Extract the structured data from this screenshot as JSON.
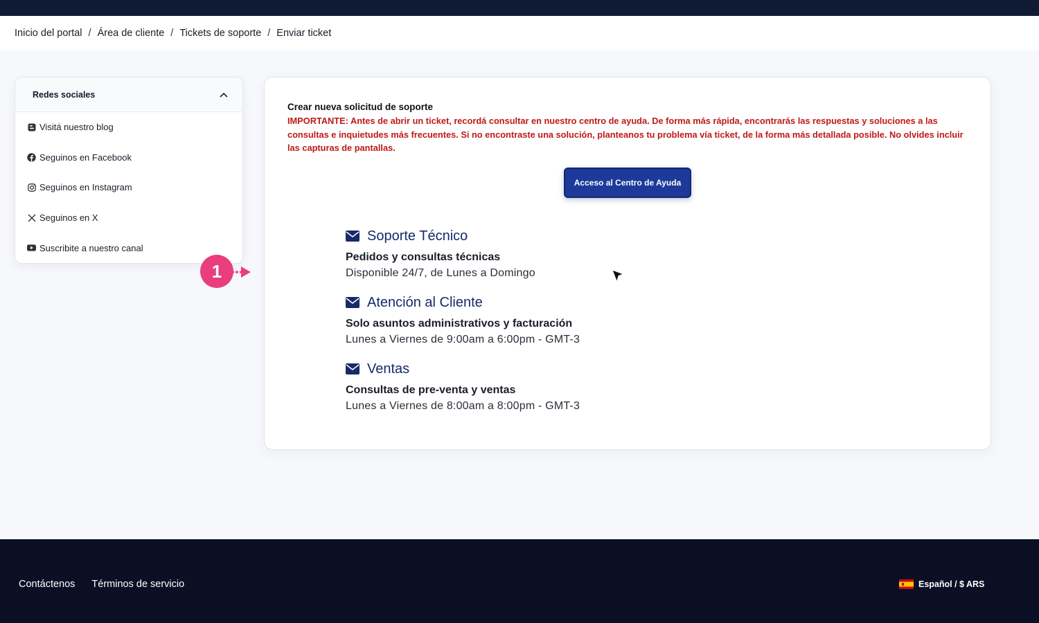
{
  "breadcrumb": {
    "items": [
      "Inicio del portal",
      "Área de cliente",
      "Tickets de soporte",
      "Enviar ticket"
    ],
    "separator": "/"
  },
  "sidebar": {
    "title": "Redes sociales",
    "items": [
      {
        "label": "Visitá nuestro blog",
        "icon": "blog-icon"
      },
      {
        "label": "Seguinos en Facebook",
        "icon": "facebook-icon"
      },
      {
        "label": "Seguinos en Instagram",
        "icon": "instagram-icon"
      },
      {
        "label": "Seguinos en X",
        "icon": "x-icon"
      },
      {
        "label": "Suscribite a nuestro canal",
        "icon": "youtube-icon"
      }
    ]
  },
  "main": {
    "title": "Crear nueva solicitud de soporte",
    "warning": "IMPORTANTE: Antes de abrir un ticket, recordá consultar en nuestro centro de ayuda. De forma más rápida, encontrarás las respuestas y soluciones a las consultas e inquietudes más frecuentes. Si no encontraste una solución, planteanos tu problema vía ticket, de la forma más detallada posible. No olvides incluir las capturas de pantallas.",
    "help_button": "Acceso al Centro de Ayuda",
    "departments": [
      {
        "name": "Soporte Técnico",
        "subtitle": "Pedidos y consultas técnicas",
        "hours": "Disponible 24/7, de Lunes a Domingo"
      },
      {
        "name": "Atención al Cliente",
        "subtitle": "Solo asuntos administrativos y facturación",
        "hours": "Lunes a Viernes de 9:00am a 6:00pm - GMT-3"
      },
      {
        "name": "Ventas",
        "subtitle": "Consultas de pre-venta y ventas",
        "hours": "Lunes a Viernes de 8:00am a 8:00pm - GMT-3"
      }
    ]
  },
  "callout": {
    "number": "1"
  },
  "footer": {
    "links": [
      "Contáctenos",
      "Términos de servicio"
    ],
    "language": "Español / $ ARS"
  },
  "colors": {
    "topbar": "#0f1a33",
    "footer": "#0a0f24",
    "accent": "#1d3a9a",
    "warning": "#c01818",
    "callout": "#e83e7d"
  }
}
